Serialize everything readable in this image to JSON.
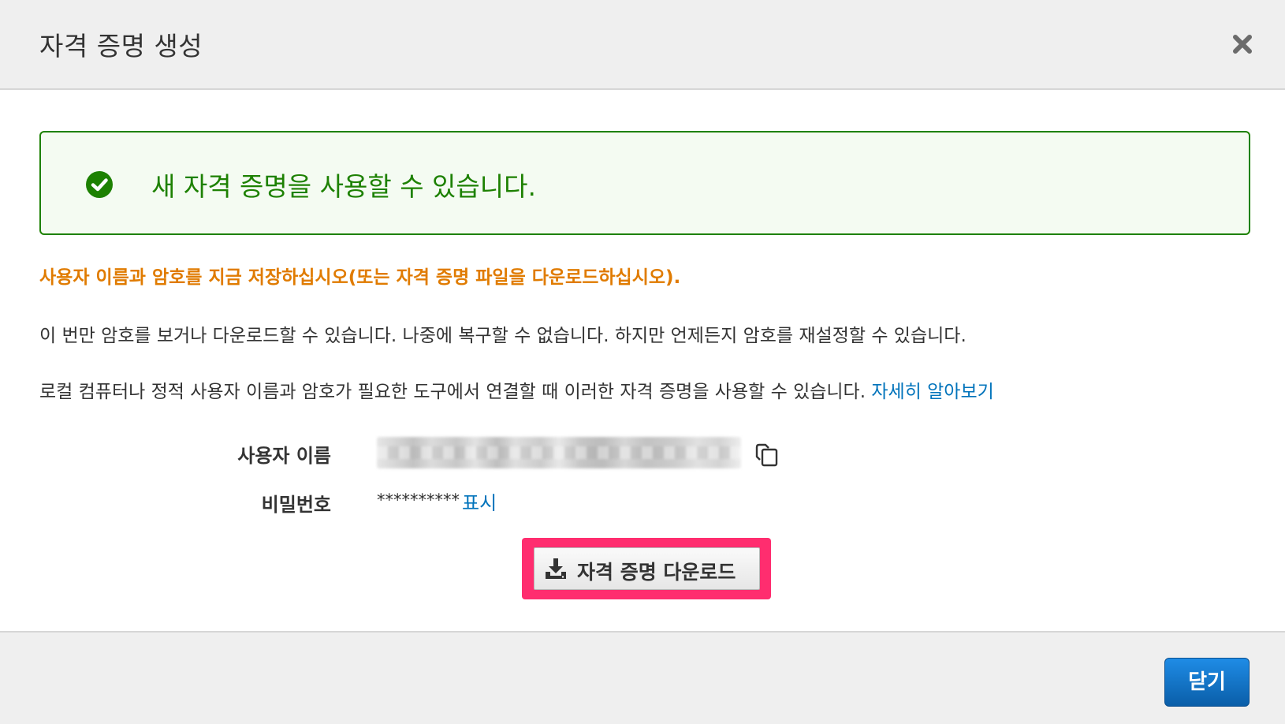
{
  "modal": {
    "title": "자격 증명 생성",
    "close_icon": "close-icon"
  },
  "alert": {
    "status": "success",
    "icon": "check-circle-icon",
    "message": "새 자격 증명을 사용할 수 있습니다."
  },
  "warning": "사용자 이름과 암호를 지금 저장하십시오(또는 자격 증명 파일을 다운로드하십시오).",
  "info": {
    "line1": "이 번만 암호를 보거나 다운로드할 수 있습니다. 나중에 복구할 수 없습니다. 하지만 언제든지 암호를 재설정할 수 있습니다.",
    "line2": "로컬 컴퓨터나 정적 사용자 이름과 암호가 필요한 도구에서 연결할 때 이러한 자격 증명을 사용할 수 있습니다.",
    "learn_more": "자세히 알아보기"
  },
  "credentials": {
    "username_label": "사용자 이름",
    "password_label": "비밀번호",
    "password_value": "**********",
    "show_label": "표시",
    "copy_icon": "copy-icon"
  },
  "download_button": {
    "label": "자격 증명 다운로드",
    "icon": "download-icon"
  },
  "footer": {
    "close_label": "닫기"
  },
  "colors": {
    "success": "#1d8102",
    "warning": "#e07b00",
    "link": "#0073bb",
    "highlight": "#ff2d6f",
    "primary": "#0a5ea8"
  }
}
